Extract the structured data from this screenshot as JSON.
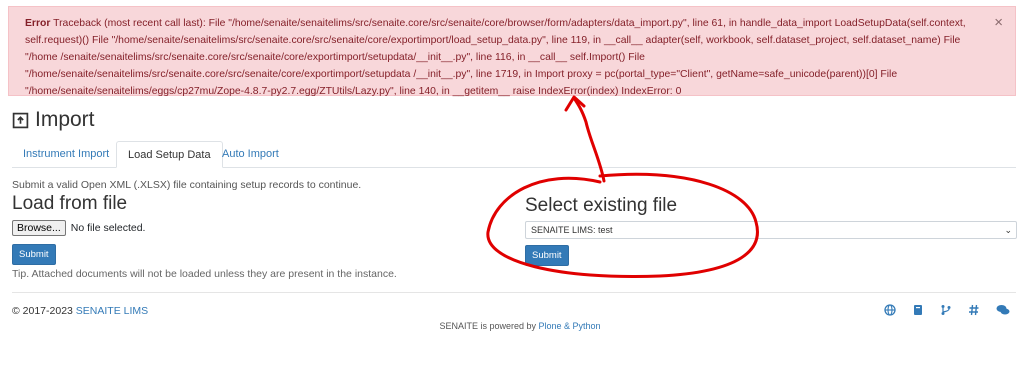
{
  "error": {
    "label": "Error",
    "text": "Traceback (most recent call last): File \"/home/senaite/senaitelims/src/senaite.core/src/senaite/core/browser/form/adapters/data_import.py\", line 61, in handle_data_import LoadSetupData(self.context, self.request)() File \"/home/senaite/senaitelims/src/senaite.core/src/senaite/core/exportimport/load_setup_data.py\", line 119, in __call__ adapter(self, workbook, self.dataset_project, self.dataset_name) File \"/home /senaite/senaitelims/src/senaite.core/src/senaite/core/exportimport/setupdata/__init__.py\", line 116, in __call__ self.Import() File \"/home/senaite/senaitelims/src/senaite.core/src/senaite/core/exportimport/setupdata /__init__.py\", line 1719, in Import proxy = pc(portal_type=\"Client\", getName=safe_unicode(parent))[0] File \"/home/senaite/senaitelims/eggs/cp27mu/Zope-4.8.7-py2.7.egg/ZTUtils/Lazy.py\", line 140, in __getitem__ raise IndexError(index) IndexError: 0",
    "close": "×"
  },
  "page": {
    "title": "Import"
  },
  "tabs": [
    "Instrument Import",
    "Load Setup Data",
    "Auto Import"
  ],
  "active_tab": "Load Setup Data",
  "load": {
    "hint": "Submit a valid Open XML (.XLSX) file containing setup records to continue.",
    "heading": "Load from file",
    "browse_label": "Browse...",
    "file_status": "No file selected.",
    "submit_label": "Submit",
    "tip": "Tip. Attached documents will not be loaded unless they are present in the instance."
  },
  "existing": {
    "heading": "Select existing file",
    "selected": "SENAITE LIMS: test",
    "submit_label": "Submit"
  },
  "footer": {
    "copyright_prefix": "© 2017-2023 ",
    "copyright_link": "SENAITE LIMS",
    "powered_prefix": "SENAITE is powered by ",
    "powered_link": "Plone & Python",
    "icons": [
      "globe-icon",
      "book-icon",
      "code-branch-icon",
      "hashtag-icon",
      "comments-icon"
    ]
  },
  "colors": {
    "accent": "#337ab7",
    "error_bg": "#f8d7da",
    "error_text": "#842029",
    "annotation": "#e00000"
  }
}
